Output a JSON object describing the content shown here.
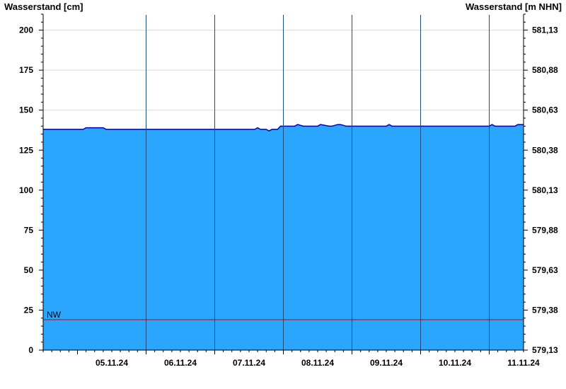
{
  "chart_data": {
    "type": "area",
    "left_axis_title": "Wasserstand [cm]",
    "right_axis_title": "Wasserstand [m NHN]",
    "ylim": [
      0,
      210
    ],
    "yticks_left": [
      "0",
      "25",
      "50",
      "75",
      "100",
      "125",
      "150",
      "175",
      "200"
    ],
    "yticks_left_values": [
      0,
      25,
      50,
      75,
      100,
      125,
      150,
      175,
      200
    ],
    "yticks_right": [
      "579,13",
      "579,38",
      "579,63",
      "579,88",
      "580,13",
      "580,38",
      "580,63",
      "580,88",
      "581,13"
    ],
    "x_start": "04.11.24 12:00",
    "x_end": "11.11.24 12:00",
    "day_labels": [
      "05.11.24",
      "06.11.24",
      "07.11.24",
      "08.11.24",
      "09.11.24",
      "10.11.24",
      "11.11.24"
    ],
    "series": [
      {
        "x": [
          "04.11.24 12:00",
          "05.11.24 02:00",
          "05.11.24 03:00",
          "05.11.24 09:00",
          "05.11.24 10:00",
          "07.11.24 12:00",
          "07.11.24 14:00",
          "07.11.24 15:00",
          "07.11.24 16:00",
          "07.11.24 18:00",
          "07.11.24 19:00",
          "07.11.24 20:00",
          "07.11.24 22:00",
          "07.11.24 23:00",
          "08.11.24 04:00",
          "08.11.24 05:00",
          "08.11.24 07:00",
          "08.11.24 12:00",
          "08.11.24 13:00",
          "08.11.24 16:00",
          "08.11.24 17:00",
          "08.11.24 19:00",
          "08.11.24 20:00",
          "08.11.24 22:00",
          "09.11.24 12:00",
          "09.11.24 13:00",
          "09.11.24 14:00",
          "11.11.24 00:00",
          "11.11.24 01:00",
          "11.11.24 02:00",
          "11.11.24 09:00",
          "11.11.24 10:00",
          "11.11.24 12:00"
        ],
        "values": [
          138,
          138,
          139,
          139,
          138,
          138,
          138,
          139,
          138,
          138,
          137,
          138,
          138,
          140,
          140,
          141,
          140,
          140,
          141,
          140,
          140,
          141,
          141,
          140,
          140,
          141,
          140,
          140,
          141,
          140,
          140,
          141,
          141
        ]
      }
    ],
    "reference_lines": [
      {
        "label": "NW",
        "value": 19,
        "color": "#cc0000"
      }
    ],
    "colors": {
      "fill": "#2ba6ff",
      "line": "#0000b4",
      "day_line": "#1a4e7a",
      "grid": "#d8d8d8"
    },
    "grid": true
  }
}
